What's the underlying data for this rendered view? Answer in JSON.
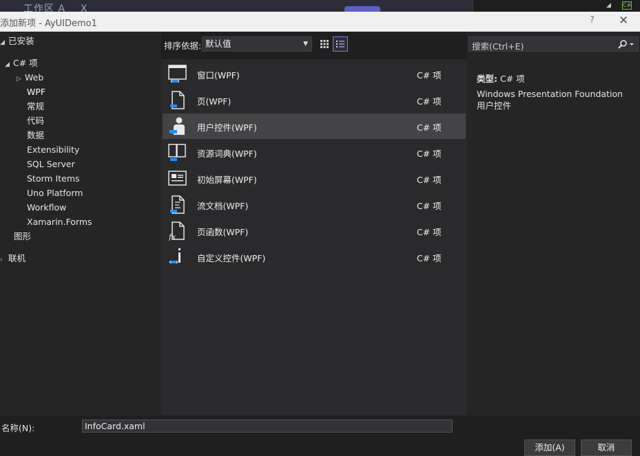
{
  "background": {
    "text": "工作区 A",
    "x_char": "X"
  },
  "dialog": {
    "title": "添加新项 - AyUIDemo1",
    "help": "?",
    "close": "✕"
  },
  "tree": {
    "installed": "已安装",
    "csharp": "C# 项",
    "items": [
      "Web",
      "WPF",
      "常规",
      "代码",
      "数据",
      "Extensibility",
      "SQL Server",
      "Storm Items",
      "Uno Platform",
      "Workflow",
      "Xamarin.Forms"
    ],
    "graphics": "图形",
    "online": "联机"
  },
  "toolbar": {
    "sort_label": "排序依据:",
    "sort_value": "默认值"
  },
  "templates": [
    {
      "name": "窗口(WPF)",
      "lang": "C# 项",
      "icon": "window-icon"
    },
    {
      "name": "页(WPF)",
      "lang": "C# 项",
      "icon": "page-icon"
    },
    {
      "name": "用户控件(WPF)",
      "lang": "C# 项",
      "icon": "user-control-icon"
    },
    {
      "name": "资源词典(WPF)",
      "lang": "C# 项",
      "icon": "resource-dictionary-icon"
    },
    {
      "name": "初始屏幕(WPF)",
      "lang": "C# 项",
      "icon": "splash-screen-icon"
    },
    {
      "name": "流文档(WPF)",
      "lang": "C# 项",
      "icon": "flow-document-icon"
    },
    {
      "name": "页函数(WPF)",
      "lang": "C# 项",
      "icon": "page-function-icon"
    },
    {
      "name": "自定义控件(WPF)",
      "lang": "C# 项",
      "icon": "custom-control-icon"
    }
  ],
  "details": {
    "search_placeholder": "搜索(Ctrl+E)",
    "type_label": "类型:",
    "type_value": "C# 项",
    "description": "Windows Presentation Foundation 用户控件"
  },
  "bottom": {
    "name_label": "名称(N):",
    "name_value": "InfoCard.xaml",
    "add_button": "添加(A)",
    "cancel_button": "取消"
  },
  "colors": {
    "accent": "#6c6cdc",
    "icon_blue": "#1e90ff",
    "selection": "#444446"
  }
}
